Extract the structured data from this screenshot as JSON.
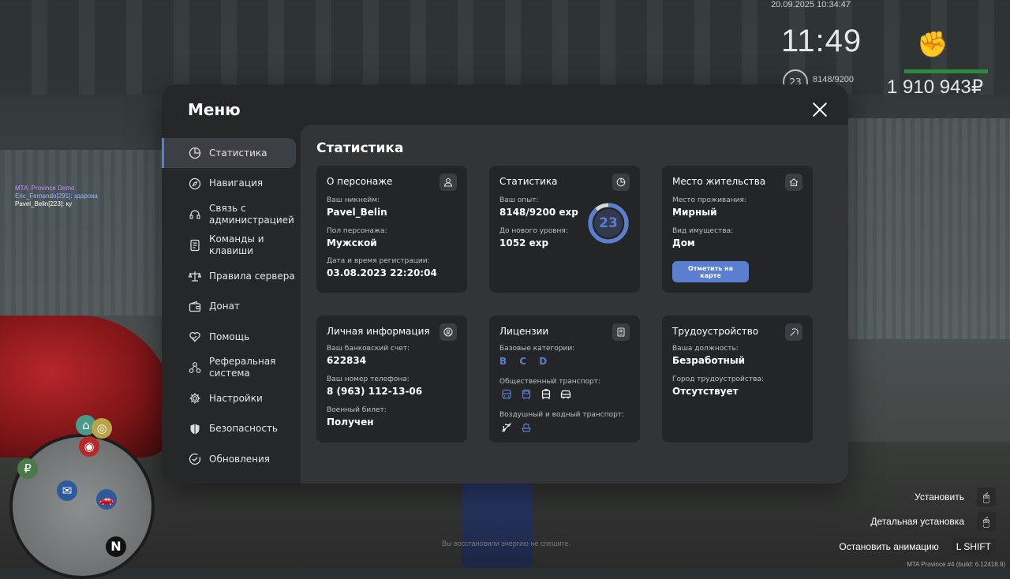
{
  "hud": {
    "datetime": "20.09.2025 10:34:47",
    "time": "11:49",
    "level": "23",
    "exp": "8148/9200",
    "money": "1 910 943₽"
  },
  "chat": [
    {
      "text": "MTA: Province Demo"
    },
    {
      "text": "Eric_Fernando[291]: здарова"
    },
    {
      "text": "Pavel_Belin[223]: ку"
    }
  ],
  "keyhints": [
    {
      "label": "Установить",
      "key": "🖱"
    },
    {
      "label": "Детальная установка",
      "key": "🖱"
    },
    {
      "label": "Остановить анимацию",
      "key": "L SHIFT"
    }
  ],
  "center_hint": "Вы восстановили энергию не спешите.",
  "build": "MTA Province #4 (build: 6.12418.9)",
  "menu": {
    "title": "Меню",
    "sidebar": [
      {
        "label": "Статистика",
        "icon": "pie-chart-icon"
      },
      {
        "label": "Навигация",
        "icon": "compass-icon"
      },
      {
        "label": "Связь с\nадминистрацией",
        "icon": "headset-icon"
      },
      {
        "label": "Команды и\nклавиши",
        "icon": "document-icon"
      },
      {
        "label": "Правила сервера",
        "icon": "scales-icon"
      },
      {
        "label": "Донат",
        "icon": "wallet-icon"
      },
      {
        "label": "Помощь",
        "icon": "heart-hand-icon"
      },
      {
        "label": "Реферальная\nсистема",
        "icon": "network-icon"
      },
      {
        "label": "Настройки",
        "icon": "gear-icon"
      },
      {
        "label": "Безопасность",
        "icon": "shield-icon"
      },
      {
        "label": "Обновления",
        "icon": "check-circle-icon"
      }
    ],
    "content_title": "Статистика",
    "cards": {
      "character": {
        "title": "О персонаже",
        "nick_label": "Ваш никнейм:",
        "nick": "Pavel_Belin",
        "gender_label": "Пол персонажа:",
        "gender": "Мужской",
        "reg_label": "Дата и время регистрации:",
        "reg": "03.08.2023 22:20:04"
      },
      "stats": {
        "title": "Статистика",
        "exp_label": "Ваш опыт:",
        "exp": "8148/9200 exp",
        "next_label": "До нового уровня:",
        "next": "1052 exp",
        "level": "23",
        "progress": 0.8857
      },
      "residence": {
        "title": "Место жительства",
        "place_label": "Место проживания:",
        "place": "Мирный",
        "property_label": "Вид имущества:",
        "property": "Дом",
        "button": "Отметить на карте"
      },
      "personal": {
        "title": "Личная информация",
        "bank_label": "Ваш банковский счет:",
        "bank": "622834",
        "phone_label": "Ваш номер телефона:",
        "phone": "8 (963) 112-13-06",
        "military_label": "Военный билет:",
        "military": "Получен"
      },
      "licenses": {
        "title": "Лицензии",
        "base_label": "Базовые категории:",
        "base": "B C D",
        "public_label": "Общественный транспорт:",
        "air_label": "Воздушный и водный транспорт:"
      },
      "employment": {
        "title": "Трудоустройство",
        "position_label": "Ваша должность:",
        "position": "Безработный",
        "city_label": "Город трудоустройства:",
        "city": "Отсутствует"
      }
    }
  },
  "colors": {
    "accent": "#5b7fd0",
    "panel": "#262729",
    "content": "#333436",
    "card": "#242527"
  }
}
